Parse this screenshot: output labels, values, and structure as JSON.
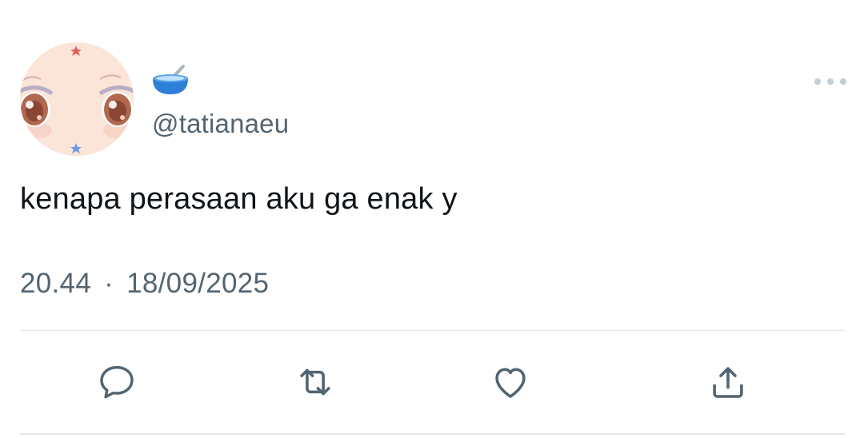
{
  "tweet": {
    "display_name_emoji": "🥣",
    "handle": "@tatianaeu",
    "text": "kenapa perasaan aku ga enak y",
    "time": "20.44",
    "separator": "·",
    "date": "18/09/2025"
  },
  "icons": {
    "avatar": "anime-eyes-avatar",
    "display_name": "bowl-with-spoon-icon",
    "more": "more-horizontal-icon",
    "reply": "reply-icon",
    "retweet": "retweet-icon",
    "like": "heart-icon",
    "share": "share-icon"
  },
  "colors": {
    "text_primary": "#0f1419",
    "text_secondary": "#536471",
    "divider": "#e1e6ea"
  }
}
